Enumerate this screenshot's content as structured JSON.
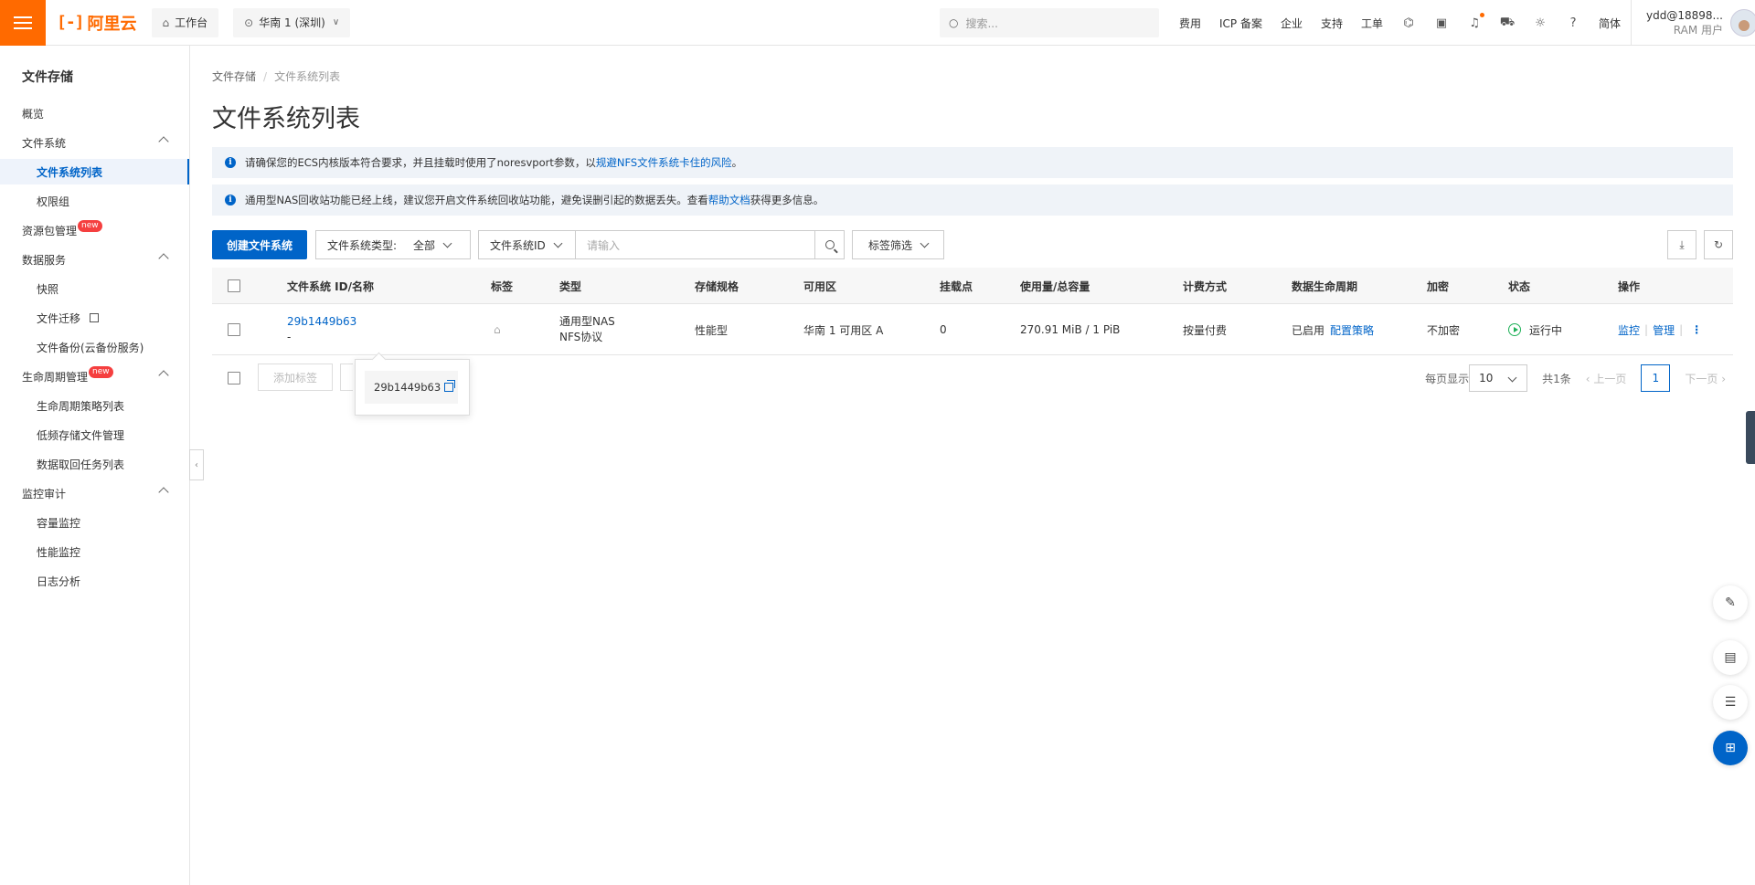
{
  "topbar": {
    "logo_text": "阿里云",
    "logo_mark": "[-]",
    "workbench": "工作台",
    "region": "华南 1 (深圳)",
    "search_placeholder": "搜索...",
    "links": [
      "费用",
      "ICP 备案",
      "企业",
      "支持",
      "工单"
    ],
    "lang": "简体",
    "user_name": "ydd@18898...",
    "user_role": "RAM 用户",
    "brand_color": "#ff6a00"
  },
  "sidebar": {
    "title": "文件存储",
    "items": [
      {
        "label": "概览"
      },
      {
        "label": "文件系统"
      },
      {
        "label": "文件系统列表"
      },
      {
        "label": "权限组"
      },
      {
        "label": "资源包管理",
        "badge": "new"
      },
      {
        "label": "数据服务"
      },
      {
        "label": "快照"
      },
      {
        "label": "文件迁移"
      },
      {
        "label": "文件备份(云备份服务)"
      },
      {
        "label": "生命周期管理",
        "badge": "new"
      },
      {
        "label": "生命周期策略列表"
      },
      {
        "label": "低频存储文件管理"
      },
      {
        "label": "数据取回任务列表"
      },
      {
        "label": "监控审计"
      },
      {
        "label": "容量监控"
      },
      {
        "label": "性能监控"
      },
      {
        "label": "日志分析"
      }
    ]
  },
  "breadcrumb": {
    "root": "文件存储",
    "sep": "/",
    "current": "文件系统列表"
  },
  "page_title": "文件系统列表",
  "alerts": [
    {
      "text": "请确保您的ECS内核版本符合要求，并且挂载时使用了noresvport参数，以",
      "link": "规避NFS文件系统卡住的风险",
      "suffix": "。"
    },
    {
      "text": "通用型NAS回收站功能已经上线，建议您开启文件系统回收站功能，避免误删引起的数据丢失。查看",
      "link": "帮助文档",
      "suffix": "获得更多信息。"
    }
  ],
  "toolbar": {
    "create_label": "创建文件系统",
    "type_filter_label": "文件系统类型:",
    "type_filter_value": "全部",
    "id_select": "文件系统ID",
    "search_placeholder": "请输入",
    "tag_filter": "标签筛选"
  },
  "table": {
    "headers": [
      "文件系统 ID/名称",
      "标签",
      "类型",
      "存储规格",
      "可用区",
      "挂载点",
      "使用量/总容量",
      "计费方式",
      "数据生命周期",
      "加密",
      "状态",
      "操作"
    ],
    "rows": [
      {
        "id": "29b1449b63",
        "name": "-",
        "type_line1": "通用型NAS",
        "type_line2": "NFS协议",
        "spec": "性能型",
        "zone": "华南 1 可用区 A",
        "mounts": "0",
        "usage": "270.91 MiB / 1 PiB",
        "billing": "按量付费",
        "lifecycle": "已启用",
        "lifecycle_link": "配置策略",
        "encryption": "不加密",
        "status": "运行中",
        "action_monitor": "监控",
        "action_manage": "管理",
        "action_more": "⋮"
      }
    ]
  },
  "footer": {
    "add_tag": "添加标签",
    "per_page_label": "每页显示",
    "per_page": "10",
    "total": "共1条",
    "prev": "上一页",
    "current_page": "1",
    "next": "下一页"
  },
  "popover": {
    "text": "29b1449b63"
  },
  "colors": {
    "accent": "#0064c8",
    "success": "#1fb158",
    "alert_bg": "#eff3f8"
  }
}
